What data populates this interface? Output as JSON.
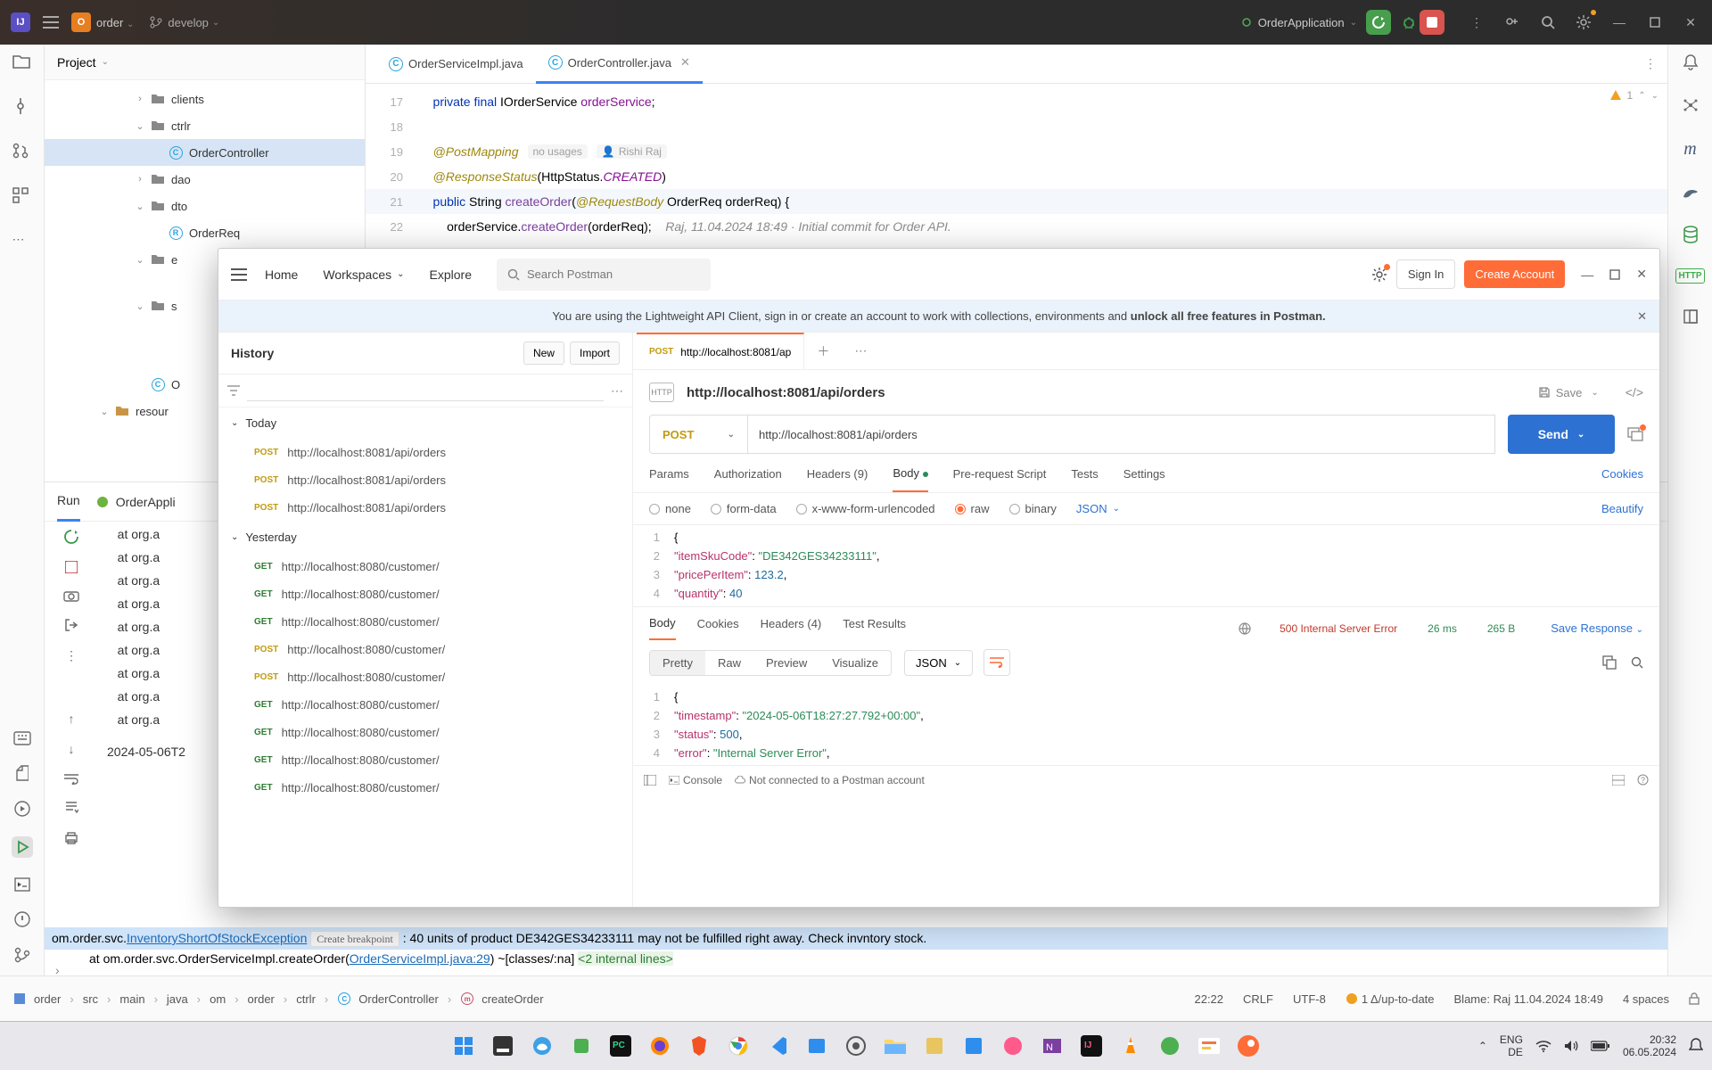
{
  "ide": {
    "project_name": "order",
    "branch": "develop",
    "run_config": "OrderApplication",
    "proj_panel_title": "Project",
    "tree": {
      "clients": "clients",
      "ctrlr": "ctrlr",
      "order_controller": "OrderController",
      "dao": "dao",
      "dto": "dto",
      "order_req": "OrderReq",
      "e_trunc": "e",
      "s_trunc": "s",
      "O_file": "O",
      "resources": "resour"
    },
    "tabs": {
      "t1": "OrderServiceImpl.java",
      "t2": "OrderController.java"
    },
    "warn_count": "1",
    "code": {
      "l17": {
        "n": "17",
        "txt_pre": "    private final ",
        "type": "IOrderService ",
        "id": "orderService",
        "post": ";"
      },
      "l18": {
        "n": "18"
      },
      "l19": {
        "n": "19",
        "ann": "    @PostMapping",
        "inlay1": "no usages",
        "inlay2": "Rishi Raj"
      },
      "l20": {
        "n": "20",
        "ann": "    @ResponseStatus",
        "args": "(HttpStatus.",
        "const": "CREATED",
        "post": ")"
      },
      "l21": {
        "n": "21",
        "pre": "    public ",
        "ret": "String ",
        "meth": "createOrder",
        "args1": "(",
        "ann2": "@RequestBody",
        "args2": " OrderReq orderReq) {"
      },
      "l22": {
        "n": "22",
        "pre": "        orderService.",
        "call": "createOrder",
        "args": "(orderReq);",
        "com": "Raj, 11.04.2024 18:49 · Initial commit for Order API."
      }
    },
    "run": {
      "tab_run": "Run",
      "tab_app": "OrderAppli",
      "stack_prefix": "   at org.a",
      "ts": "2024-05-06T2"
    },
    "exception": {
      "pkg": "om.order.svc.",
      "cls": "InventoryShortOfStockException",
      "hint": "Create breakpoint",
      "msg": " : 40 units of product DE342GES34233111 may not be fulfilled right away. Check invntory stock.",
      "l2_pre": "    at om.order.svc.OrderServiceImpl.createOrder(",
      "l2_link": "OrderServiceImpl.java:29",
      "l2_post": ") ~[classes/:na] ",
      "l2_tail": "<2 internal lines>"
    },
    "status": {
      "crumbs": [
        "order",
        "src",
        "main",
        "java",
        "om",
        "order",
        "ctrlr",
        "OrderController",
        "createOrder"
      ],
      "pos": "22:22",
      "eol": "CRLF",
      "enc": "UTF-8",
      "git": "1 Δ/up-to-date",
      "blame": "Blame: Raj 11.04.2024 18:49",
      "spaces": "4 spaces"
    }
  },
  "postman": {
    "nav": {
      "home": "Home",
      "ws": "Workspaces",
      "explore": "Explore",
      "search": "Search Postman",
      "signin": "Sign In",
      "create": "Create Account"
    },
    "banner_a": "You are using the Lightweight API Client, sign in or create an account to work with collections, environments and ",
    "banner_b": "unlock all free features in Postman.",
    "history": {
      "title": "History",
      "new": "New",
      "import": "Import",
      "today": "Today",
      "yesterday": "Yesterday",
      "today_items": [
        {
          "m": "POST",
          "u": "http://localhost:8081/api/orders"
        },
        {
          "m": "POST",
          "u": "http://localhost:8081/api/orders"
        },
        {
          "m": "POST",
          "u": "http://localhost:8081/api/orders"
        }
      ],
      "y_items": [
        {
          "m": "GET",
          "u": "http://localhost:8080/customer/"
        },
        {
          "m": "GET",
          "u": "http://localhost:8080/customer/"
        },
        {
          "m": "GET",
          "u": "http://localhost:8080/customer/"
        },
        {
          "m": "POST",
          "u": "http://localhost:8080/customer/"
        },
        {
          "m": "POST",
          "u": "http://localhost:8080/customer/"
        },
        {
          "m": "GET",
          "u": "http://localhost:8080/customer/"
        },
        {
          "m": "GET",
          "u": "http://localhost:8080/customer/"
        },
        {
          "m": "GET",
          "u": "http://localhost:8080/customer/"
        },
        {
          "m": "GET",
          "u": "http://localhost:8080/customer/"
        }
      ]
    },
    "req": {
      "tab_method": "POST",
      "tab_url": "http://localhost:8081/ap",
      "title": "http://localhost:8081/api/orders",
      "save": "Save",
      "method": "POST",
      "url": "http://localhost:8081/api/orders",
      "send": "Send",
      "subtabs": {
        "params": "Params",
        "auth": "Authorization",
        "headers": "Headers (9)",
        "body": "Body",
        "pre": "Pre-request Script",
        "tests": "Tests",
        "settings": "Settings",
        "cookies": "Cookies"
      },
      "bodytype": {
        "none": "none",
        "form": "form-data",
        "xwww": "x-www-form-urlencoded",
        "raw": "raw",
        "binary": "binary",
        "json": "JSON",
        "beautify": "Beautify"
      },
      "json": [
        {
          "n": "1",
          "txt": "{"
        },
        {
          "n": "2",
          "k": "\"itemSkuCode\"",
          "v": "\"DE342GES34233111\"",
          "c": ","
        },
        {
          "n": "3",
          "k": "\"pricePerItem\"",
          "v": "123.2",
          "c": ","
        },
        {
          "n": "4",
          "k": "\"quantity\"",
          "v": "40",
          "c": ""
        }
      ]
    },
    "resp": {
      "tabs": {
        "body": "Body",
        "cookies": "Cookies",
        "headers": "Headers (4)",
        "tests": "Test Results"
      },
      "status": "500 Internal Server Error",
      "time": "26 ms",
      "size": "265 B",
      "save": "Save Response",
      "view": {
        "pretty": "Pretty",
        "raw": "Raw",
        "preview": "Preview",
        "visualize": "Visualize",
        "json": "JSON"
      },
      "json": [
        {
          "n": "1",
          "txt": "{"
        },
        {
          "n": "2",
          "k": "\"timestamp\"",
          "v": "\"2024-05-06T18:27:27.792+00:00\"",
          "c": ","
        },
        {
          "n": "3",
          "k": "\"status\"",
          "v": "500",
          "c": ","
        },
        {
          "n": "4",
          "k": "\"error\"",
          "v": "\"Internal Server Error\"",
          "c": ","
        }
      ]
    },
    "footer": {
      "console": "Console",
      "agent": "Not connected to a Postman account"
    }
  },
  "taskbar": {
    "lang": "ENG",
    "kb": "DE",
    "time": "20:32",
    "date": "06.05.2024"
  }
}
